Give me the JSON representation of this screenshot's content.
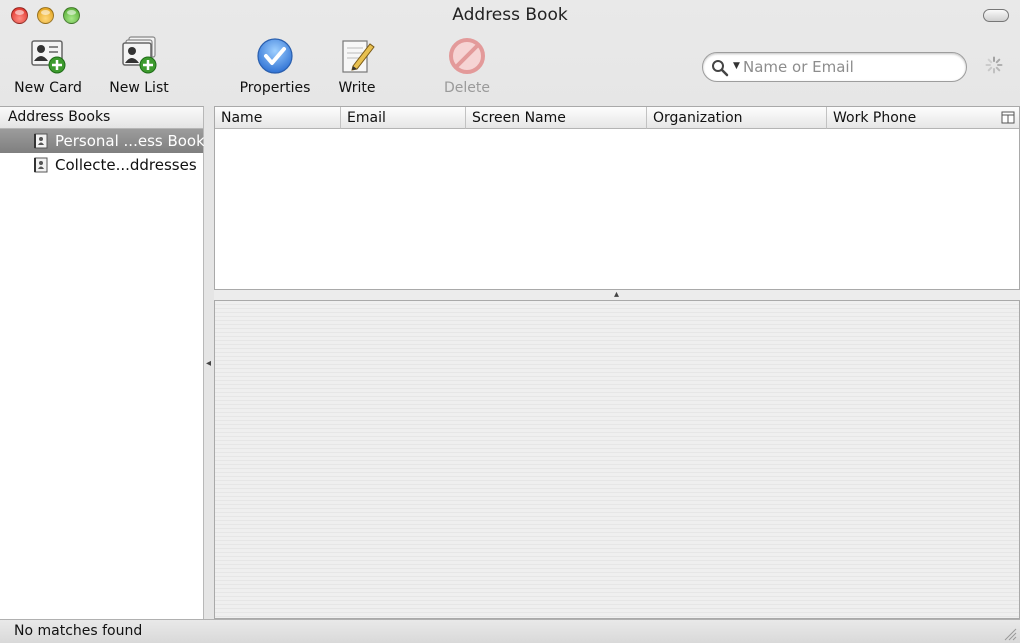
{
  "window": {
    "title": "Address Book"
  },
  "toolbar": {
    "new_card": {
      "label": "New Card",
      "icon": "new-card-icon"
    },
    "new_list": {
      "label": "New List",
      "icon": "new-list-icon"
    },
    "properties": {
      "label": "Properties",
      "icon": "checkmark-icon"
    },
    "write": {
      "label": "Write",
      "icon": "pencil-icon"
    },
    "delete": {
      "label": "Delete",
      "icon": "prohibited-icon",
      "enabled": false
    }
  },
  "search": {
    "placeholder": "Name or Email",
    "value": ""
  },
  "sidebar": {
    "header": "Address Books",
    "items": [
      {
        "label": "Personal ...ess Book",
        "selected": true,
        "icon": "address-book-icon"
      },
      {
        "label": "Collecte...ddresses",
        "selected": false,
        "icon": "address-book-icon"
      }
    ]
  },
  "cardlist": {
    "columns": [
      "Name",
      "Email",
      "Screen Name",
      "Organization",
      "Work Phone"
    ],
    "rows": []
  },
  "status": {
    "text": "No matches found"
  },
  "colors": {
    "selection": "#8e8e8e",
    "properties_blue": "#3a82dd",
    "delete_red": "#e39a9a"
  }
}
